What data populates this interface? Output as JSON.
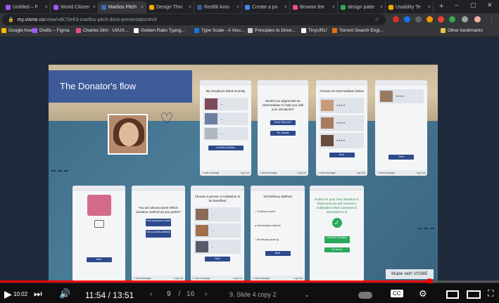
{
  "browser": {
    "tabs": [
      {
        "title": "Untitled – F",
        "fav": "#a259ff"
      },
      {
        "title": "World Citizen",
        "fav": "#a259ff"
      },
      {
        "title": "Marlios Pitch",
        "fav": "#3b6db3"
      },
      {
        "title": "Design Thin",
        "fav": "#f2a900"
      },
      {
        "title": "Reddit Amo",
        "fav": "#3e5a98"
      },
      {
        "title": "Create a po",
        "fav": "#4285f4"
      },
      {
        "title": "Browse the",
        "fav": "#ea4c89"
      },
      {
        "title": "design patte",
        "fav": "#34a853"
      },
      {
        "title": "Usability Te",
        "fav": "#f2a900"
      }
    ],
    "url_host": "my.visme.co",
    "url_path": "/view/vdk70e63-marllos-pitch-deck-presentation#s9",
    "bookmarks": [
      {
        "label": "Google Keep",
        "fav": "#fbbc04"
      },
      {
        "label": "Drafts – Figma",
        "fav": "#a259ff"
      },
      {
        "label": "Charles Dim · UI/UX...",
        "fav": "#ea4c89"
      },
      {
        "label": "Golden Ratio Typog...",
        "fav": "#ffffff"
      },
      {
        "label": "Type Scale - A Visu...",
        "fav": "#1a73e8"
      },
      {
        "label": "Principles to Drive...",
        "fav": "#cccccc"
      },
      {
        "label": "TinyURL!",
        "fav": "#ffffff"
      },
      {
        "label": "Torrent Search Engi...",
        "fav": "#e8710a"
      }
    ],
    "other_bookmarks": "Other bookmarks"
  },
  "slide": {
    "title": "The Donator's flow",
    "watermark": "Made with VISME",
    "cards_top": [
      {
        "title": "My donations listed recently",
        "btn": "List New Clothes",
        "footer": "1 new message"
      },
      {
        "title": "Would you appreciate an intermediator to help you with your donations?",
        "btn": "Sure! Why not?",
        "btn2": "No, thanks",
        "footer": "1 new message"
      },
      {
        "title": "Choose an Intermediator below",
        "btn": "Next",
        "footer": "1 new message"
      },
      {
        "title": "",
        "btn": "Next",
        "footer": "1 new message"
      }
    ],
    "cards_bottom": [
      {
        "title": "",
        "btn": "Next",
        "footer": ""
      },
      {
        "title": "You are almost done! Which donation method do you prefer?",
        "btn": "Find someone in need",
        "btn2": "List on public platform",
        "footer": "1 new message"
      },
      {
        "title": "Choose a person or institution to be benefited",
        "btn": "Next",
        "footer": "1 new message"
      },
      {
        "title": "Set Delivery Method",
        "options": [
          "I'll deliver myself",
          "Intermediator delivers",
          "Beneficiary picks up"
        ],
        "btn": "Next",
        "footer": "1 new message"
      },
      {
        "title": "Kudos for you! Your donation is listed and you will receive a notification when someone is interested in it!",
        "btn": "List New Donation",
        "btn2": "Go Home",
        "footer": ""
      }
    ]
  },
  "player": {
    "current_time": "11:54",
    "duration": "13:51",
    "time_sep": "/",
    "slide_current": "9",
    "slide_sep": "/",
    "slide_total": "16",
    "chapter": "9. Slide 4 copy 2",
    "progress": 0.86,
    "prev_time": "10:02"
  }
}
